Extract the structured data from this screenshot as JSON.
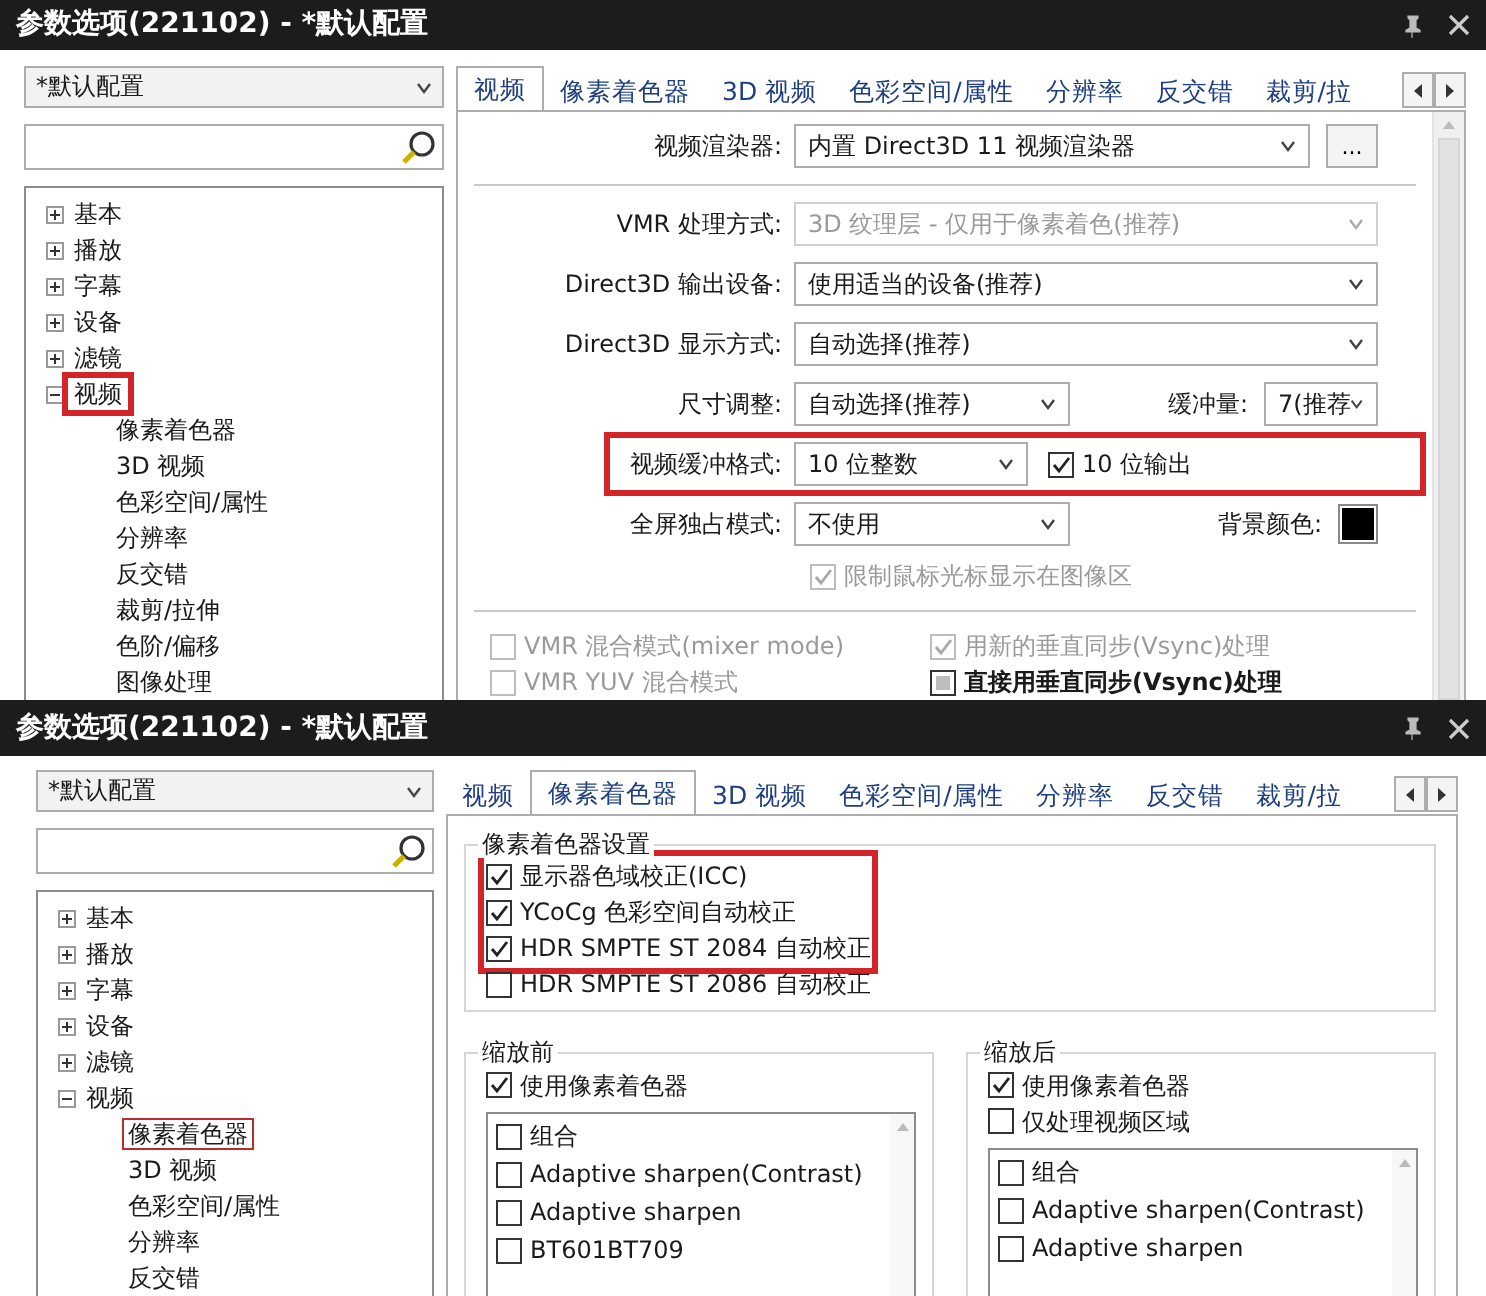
{
  "windows": [
    {
      "title": "参数选项(221102) - *默认配置",
      "profile": "*默认配置",
      "tree": [
        {
          "label": "基本",
          "expanded": false,
          "highlighted": false
        },
        {
          "label": "播放",
          "expanded": false,
          "highlighted": false
        },
        {
          "label": "字幕",
          "expanded": false,
          "highlighted": false
        },
        {
          "label": "设备",
          "expanded": false,
          "highlighted": false
        },
        {
          "label": "滤镜",
          "expanded": false,
          "highlighted": false
        },
        {
          "label": "视频",
          "expanded": true,
          "highlighted": true,
          "children": [
            {
              "label": "像素着色器",
              "highlighted": false
            },
            {
              "label": "3D 视频",
              "highlighted": false
            },
            {
              "label": "色彩空间/属性",
              "highlighted": false
            },
            {
              "label": "分辨率",
              "highlighted": false
            },
            {
              "label": "反交错",
              "highlighted": false
            },
            {
              "label": "裁剪/拉伸",
              "highlighted": false
            },
            {
              "label": "色阶/偏移",
              "highlighted": false
            },
            {
              "label": "图像处理",
              "highlighted": false
            }
          ]
        }
      ],
      "tabs": [
        {
          "label": "视频",
          "selected": true
        },
        {
          "label": "像素着色器",
          "selected": false
        },
        {
          "label": "3D 视频",
          "selected": false
        },
        {
          "label": "色彩空间/属性",
          "selected": false
        },
        {
          "label": "分辨率",
          "selected": false
        },
        {
          "label": "反交错",
          "selected": false
        },
        {
          "label": "裁剪/拉",
          "selected": false
        }
      ],
      "panel": {
        "kind": "video",
        "renderer": {
          "label": "视频渲染器:",
          "value": "内置 Direct3D 11 视频渲染器",
          "button": "..."
        },
        "rows": [
          {
            "label": "VMR 处理方式:",
            "value": "3D 纹理层 - 仅用于像素着色(推荐)",
            "disabled": true,
            "highlighted": false
          },
          {
            "label": "Direct3D 输出设备:",
            "value": "使用适当的设备(推荐)",
            "disabled": false,
            "highlighted": false
          },
          {
            "label": "Direct3D 显示方式:",
            "value": "自动选择(推荐)",
            "disabled": false,
            "highlighted": false
          },
          {
            "label": "尺寸调整:",
            "value": "自动选择(推荐)",
            "disabled": false,
            "highlighted": false,
            "side": {
              "kind": "select",
              "label": "缓冲量:",
              "value": "7(推荐"
            }
          },
          {
            "label": "视频缓冲格式:",
            "value": "10 位整数",
            "disabled": false,
            "highlighted": true,
            "side": {
              "kind": "checkbox",
              "label": "10 位输出",
              "checked": true
            }
          },
          {
            "label": "全屏独占模式:",
            "value": "不使用",
            "disabled": false,
            "highlighted": false,
            "side": {
              "kind": "color",
              "label": "背景颜色:",
              "color": "#000000"
            }
          }
        ],
        "cursor_option": {
          "label": "限制鼠标光标显示在图像区",
          "checked": true,
          "disabled": true
        },
        "options": [
          {
            "label": "VMR 混合模式(mixer mode)",
            "checked": false,
            "disabled": true,
            "bold": false
          },
          {
            "label": "用新的垂直同步(Vsync)处理",
            "checked": true,
            "disabled": true,
            "bold": false
          },
          {
            "label": "VMR YUV 混合模式",
            "checked": false,
            "disabled": true,
            "bold": false
          },
          {
            "label": "直接用垂直同步(Vsync)处理",
            "checked": false,
            "indeterminate": true,
            "disabled": false,
            "bold": true
          }
        ]
      }
    },
    {
      "title": "参数选项(221102) - *默认配置",
      "profile": "*默认配置",
      "tree": [
        {
          "label": "基本",
          "expanded": false,
          "highlighted": false
        },
        {
          "label": "播放",
          "expanded": false,
          "highlighted": false
        },
        {
          "label": "字幕",
          "expanded": false,
          "highlighted": false
        },
        {
          "label": "设备",
          "expanded": false,
          "highlighted": false
        },
        {
          "label": "滤镜",
          "expanded": false,
          "highlighted": false
        },
        {
          "label": "视频",
          "expanded": true,
          "highlighted": false,
          "children": [
            {
              "label": "像素着色器",
              "highlighted": true
            },
            {
              "label": "3D 视频",
              "highlighted": false
            },
            {
              "label": "色彩空间/属性",
              "highlighted": false
            },
            {
              "label": "分辨率",
              "highlighted": false
            },
            {
              "label": "反交错",
              "highlighted": false
            }
          ]
        }
      ],
      "tabs": [
        {
          "label": "视频",
          "selected": false
        },
        {
          "label": "像素着色器",
          "selected": true
        },
        {
          "label": "3D 视频",
          "selected": false
        },
        {
          "label": "色彩空间/属性",
          "selected": false
        },
        {
          "label": "分辨率",
          "selected": false
        },
        {
          "label": "反交错",
          "selected": false
        },
        {
          "label": "裁剪/拉",
          "selected": false
        }
      ],
      "panel": {
        "kind": "shaders",
        "settings": {
          "title": "像素着色器设置",
          "options": [
            {
              "label": "显示器色域校正(ICC)",
              "checked": true,
              "highlighted": true
            },
            {
              "label": "YCoCg 色彩空间自动校正",
              "checked": true,
              "highlighted": true
            },
            {
              "label": "HDR SMPTE ST 2084 自动校正",
              "checked": true,
              "highlighted": true
            },
            {
              "label": "HDR SMPTE ST 2086 自动校正",
              "checked": false,
              "highlighted": false
            }
          ]
        },
        "stages": [
          {
            "title": "缩放前",
            "options": [
              {
                "label": "使用像素着色器",
                "checked": true
              }
            ],
            "list": [
              {
                "label": "组合",
                "checked": false
              },
              {
                "label": "Adaptive sharpen(Contrast)",
                "checked": false
              },
              {
                "label": "Adaptive sharpen",
                "checked": false
              },
              {
                "label": "BT601BT709",
                "checked": false
              }
            ]
          },
          {
            "title": "缩放后",
            "options": [
              {
                "label": "使用像素着色器",
                "checked": true
              },
              {
                "label": "仅处理视频区域",
                "checked": false
              }
            ],
            "list": [
              {
                "label": "组合",
                "checked": false
              },
              {
                "label": "Adaptive sharpen(Contrast)",
                "checked": false
              },
              {
                "label": "Adaptive sharpen",
                "checked": false
              }
            ]
          }
        ]
      }
    }
  ]
}
